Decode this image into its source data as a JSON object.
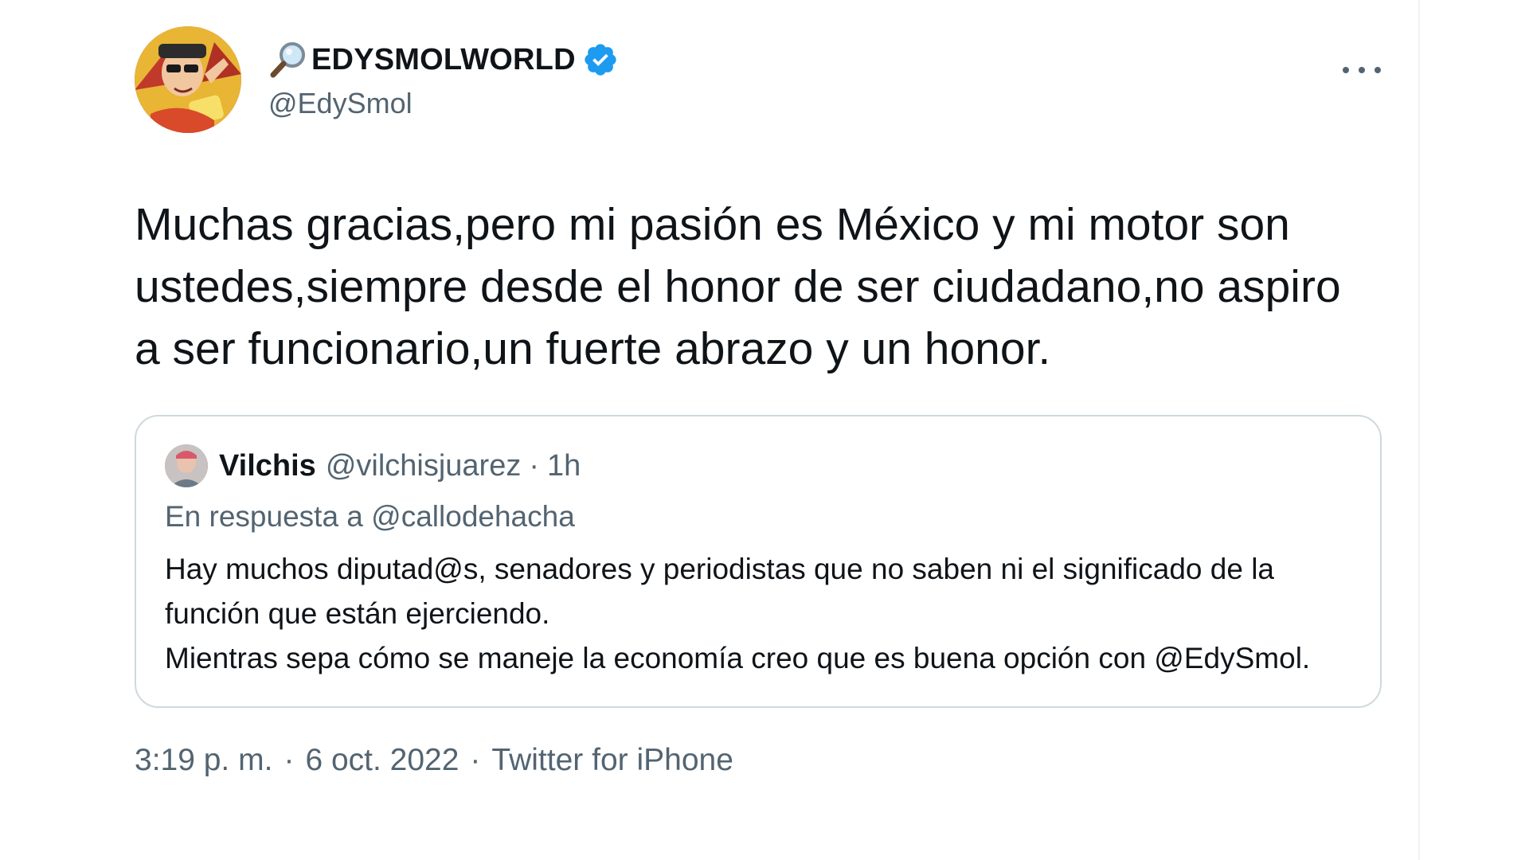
{
  "author": {
    "display_name": "EDYSMOLWORLD",
    "handle": "@EdySmol",
    "verified": true,
    "name_prefix_icon": "magnifying-glass-icon",
    "avatar_icon": "cartoon-avatar"
  },
  "tweet": {
    "text": "Muchas gracias,pero mi pasión es México y mi motor son ustedes,siempre desde el honor de ser ciudadano,no aspiro a ser funcionario,un fuerte abrazo y un honor."
  },
  "quote": {
    "name": "Vilchis",
    "handle": "@vilchisjuarez",
    "separator": "·",
    "time": "1h",
    "reply_prefix": "En respuesta a",
    "reply_to": "@callodehacha",
    "text": "Hay muchos diputad@s, senadores y periodistas que no saben ni el significado de la función que están ejerciendo.\nMientras sepa cómo se maneje la economía creo que es buena opción con @EdySmol."
  },
  "meta": {
    "time": "3:19 p. m.",
    "separator": "·",
    "date": "6 oct. 2022",
    "source": "Twitter for iPhone"
  },
  "colors": {
    "text_primary": "#0f1419",
    "text_secondary": "#536471",
    "verified_blue": "#1d9bf0",
    "border": "#cfd9de"
  }
}
